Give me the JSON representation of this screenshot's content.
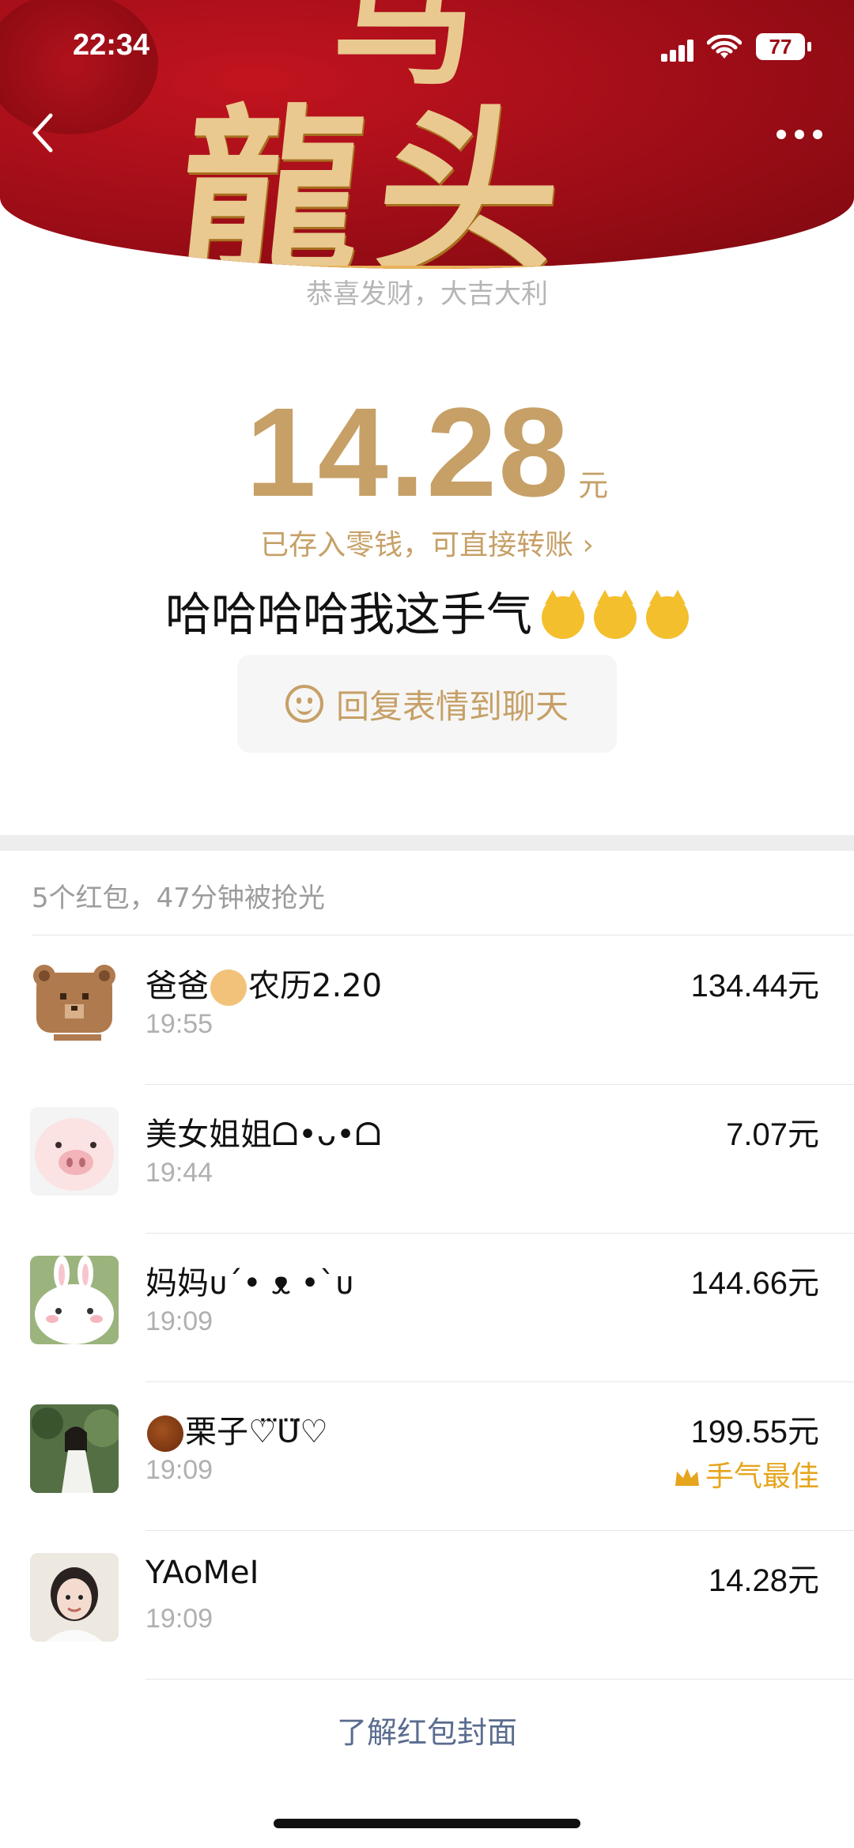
{
  "status_bar": {
    "time": "22:34",
    "battery": "77"
  },
  "header": {
    "calligraphy": "龍头",
    "calligraphy_top": "马"
  },
  "subtitle": "恭喜发财，大吉大利",
  "amount": {
    "value": "14.28",
    "unit": "元"
  },
  "stored_text": "已存入零钱，可直接转账 ›",
  "blessing": "哈哈哈哈我这手气",
  "reply_button": {
    "label": "回复表情到聊天"
  },
  "summary": "5个红包，47分钟被抢光",
  "records": [
    {
      "name": "爸爸",
      "name_suffix": "农历2.20",
      "time": "19:55",
      "amount": "134.44元"
    },
    {
      "name": "美女姐姐ᗝ•ᴗ•ᗝ",
      "time": "19:44",
      "amount": "7.07元"
    },
    {
      "name": "妈妈ᴜ´• ᴥ •`ᴜ",
      "time": "19:09",
      "amount": "144.66元"
    },
    {
      "name": "栗子♡⃛ᑌ⃛♡",
      "time": "19:09",
      "amount": "199.55元",
      "badge": "手气最佳"
    },
    {
      "name": "YAoMeI",
      "time": "19:09",
      "amount": "14.28元"
    }
  ],
  "footer_link": "了解红包封面",
  "colors": {
    "gold": "#c6a067",
    "red": "#9e0d17",
    "best": "#e6a51e"
  }
}
